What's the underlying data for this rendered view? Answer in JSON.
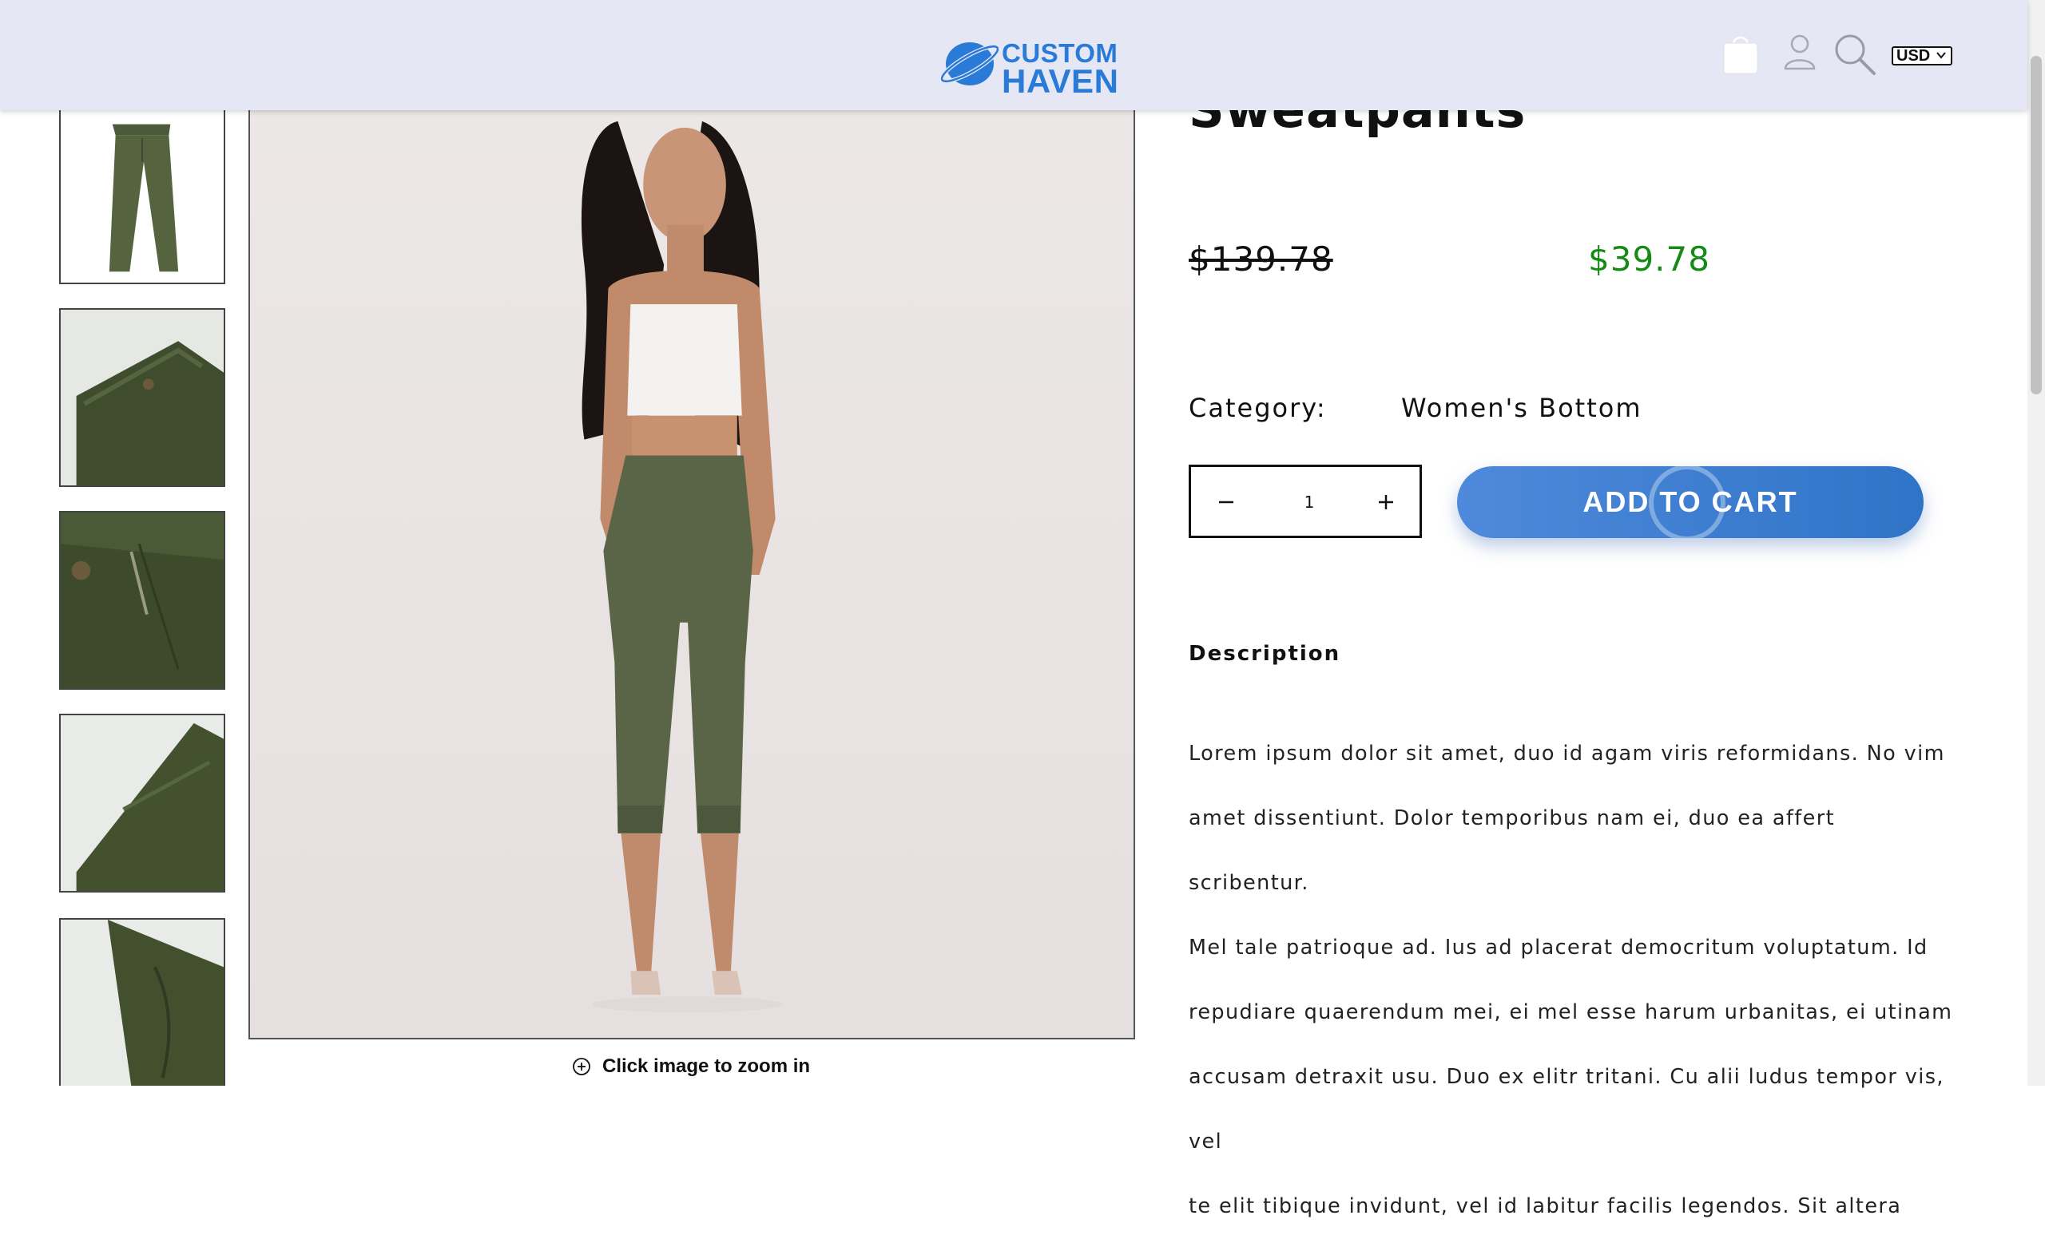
{
  "header": {
    "logo_line1": "CUSTOM",
    "logo_line2": "HAVEN",
    "currency": "USD",
    "icons": [
      "cart-icon",
      "user-icon",
      "search-icon"
    ]
  },
  "gallery": {
    "thumbnails": [
      "thumbnail-1",
      "thumbnail-2",
      "thumbnail-3",
      "thumbnail-4",
      "thumbnail-5"
    ],
    "zoom_hint": "Click image to zoom in"
  },
  "product": {
    "title": "Sweatpants",
    "price_old": "$139.78",
    "price_new": "$39.78",
    "category_label": "Category:",
    "category_value": "Women's Bottom",
    "quantity": "1",
    "add_to_cart": "ADD TO CART",
    "description_heading": "Description",
    "description_lines": [
      "Lorem ipsum dolor sit amet, duo id agam viris reformidans. No vim",
      "amet dissentiunt. Dolor temporibus nam ei, duo ea affert scribentur.",
      "Mel tale patrioque ad. Ius ad placerat democritum voluptatum. Id",
      "repudiare quaerendum mei, ei mel esse harum urbanitas, ei utinam",
      "accusam detraxit usu. Duo ex elitr tritani. Cu alii ludus tempor vis, vel",
      "te elit tibique invidunt, vel id labitur facilis legendos. Sit altera"
    ]
  },
  "colors": {
    "header_bg": "#e5e8f4",
    "brand_blue": "#2a7bd8",
    "sale_price": "#168a16",
    "button_gradient_start": "#4f89db",
    "button_gradient_end": "#2f74c7"
  }
}
